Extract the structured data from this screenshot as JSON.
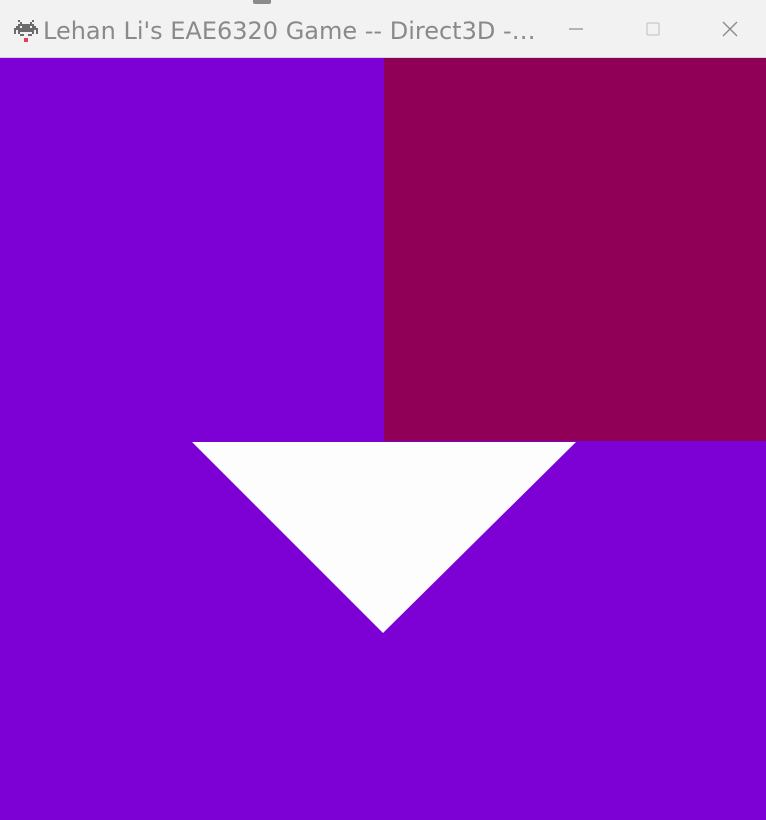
{
  "window": {
    "title": "Lehan Li's EAE6320 Game -- Direct3D --...",
    "icon": "space-invader-icon",
    "controls": {
      "minimize_icon": "minimize-icon",
      "maximize_icon": "maximize-icon",
      "close_icon": "close-icon"
    }
  },
  "scene": {
    "background_color": "#7d00d4",
    "rectangle_color": "#910057",
    "triangle_color": "#fdfdfd"
  }
}
